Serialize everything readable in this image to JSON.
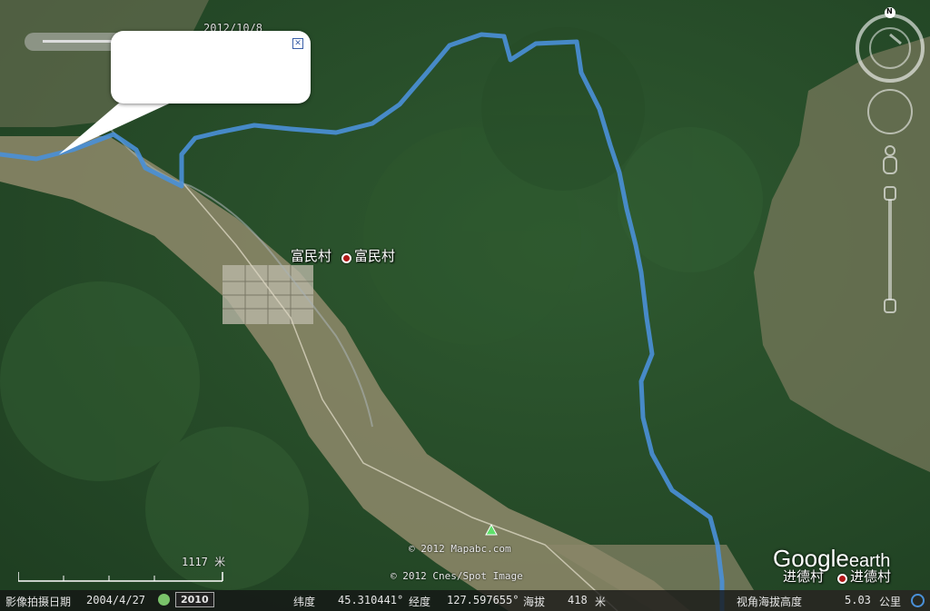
{
  "app": {
    "logo_main": "Google",
    "logo_sub": "earth",
    "colors": {
      "track": "#4a90d8",
      "forest": "#274c2a",
      "field": "#8c8a6c"
    }
  },
  "top_partial_date": "2012/10/8",
  "balloon": {
    "close_icon": "close-icon"
  },
  "places": {
    "fumin_left": "富民村",
    "fumin_right": "富民村",
    "jinde_left": "进德村",
    "jinde_right": "进德村"
  },
  "copyrights": {
    "mapabc": "© 2012 Mapabc.com",
    "spot": "© 2012 Cnes/Spot Image"
  },
  "scale": {
    "label": "1117 米"
  },
  "status": {
    "imagery_date_label": "影像拍摄日期",
    "imagery_date": "2004/4/27",
    "year_badge": "2010",
    "lat_label": "纬度",
    "lat": "45.310441°",
    "lon_label": "经度",
    "lon": "127.597655°",
    "elev_label": "海拔",
    "elev": "418",
    "elev_unit": "米",
    "eye_label": "视角海拔高度",
    "eye": "5.03",
    "eye_unit": "公里"
  },
  "nav": {
    "north": "N"
  }
}
